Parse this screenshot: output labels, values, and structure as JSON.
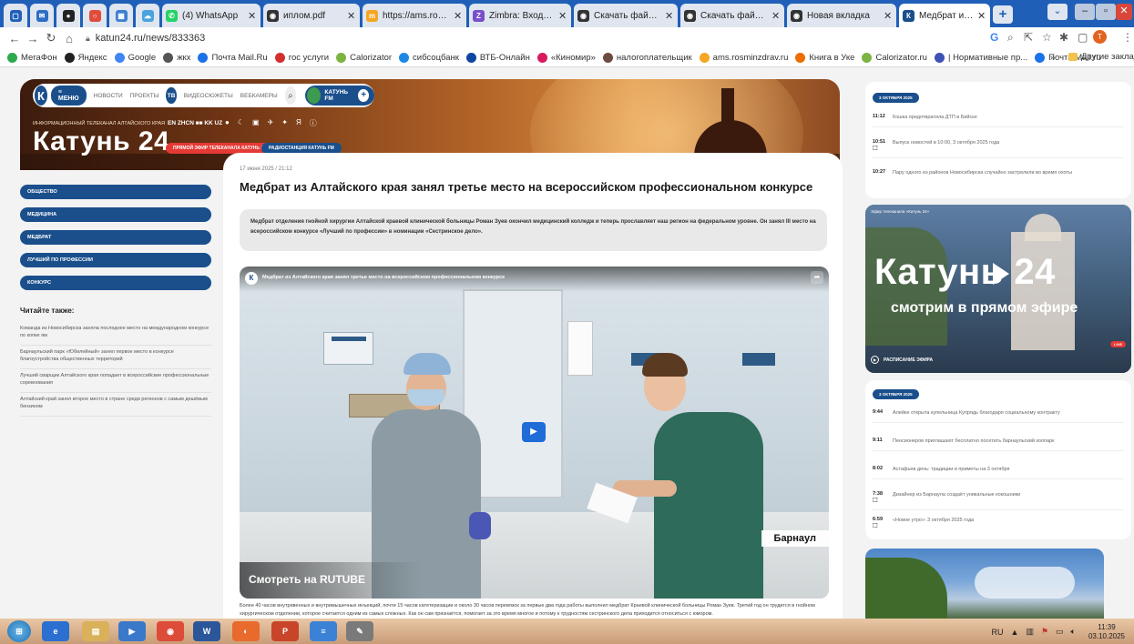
{
  "browser": {
    "tabs": [
      {
        "label": "",
        "favicon": "chrome-app-icon",
        "color": "#1f5fb8"
      },
      {
        "label": "",
        "favicon": "mail-app-icon",
        "color": "#2d6cc7"
      },
      {
        "label": "",
        "favicon": "zen-icon",
        "color": "#222222"
      },
      {
        "label": "",
        "favicon": "circle-icon",
        "color": "#e04b3c"
      },
      {
        "label": "",
        "favicon": "chart-icon",
        "color": "#3d7fd1"
      },
      {
        "label": "",
        "favicon": "cloud-icon",
        "color": "#4aa3df"
      },
      {
        "label": "(4) WhatsApp",
        "favicon": "whatsapp-icon",
        "color": "#25d366"
      },
      {
        "label": "иплом.pdf",
        "favicon": "pdf-icon",
        "color": "#333333"
      },
      {
        "label": "https://ams.rosminzd",
        "favicon": "ams-icon",
        "color": "#f5a623"
      },
      {
        "label": "Zimbra: Входящие (1",
        "favicon": "zimbra-icon",
        "color": "#7b4fc9"
      },
      {
        "label": "Скачать файл | iLovel",
        "favicon": "ilove-icon",
        "color": "#333333"
      },
      {
        "label": "Скачать файл | iLovel",
        "favicon": "ilove-icon",
        "color": "#333333"
      },
      {
        "label": "Новая вкладка",
        "favicon": "newtab-icon",
        "color": "#333333"
      },
      {
        "label": "Медбрат из Алтайск",
        "favicon": "katun-icon",
        "color": "#1a4f8c"
      }
    ],
    "url": "katun24.ru/news/833363",
    "bookmarks": [
      {
        "label": "МегаФон",
        "color": "#2eaa4c"
      },
      {
        "label": "Яндекс",
        "color": "#222222"
      },
      {
        "label": "Google",
        "color": "#4285f4"
      },
      {
        "label": "жкх",
        "color": "#555555"
      },
      {
        "label": "Почта Mail.Ru",
        "color": "#1a73e8"
      },
      {
        "label": "гос услуги",
        "color": "#d32f2f"
      },
      {
        "label": "Calorizator",
        "color": "#7cb342"
      },
      {
        "label": "сибсоцбанк",
        "color": "#1e88e5"
      },
      {
        "label": "ВТБ-Онлайн",
        "color": "#0d47a1"
      },
      {
        "label": "«Киномир»",
        "color": "#d81b60"
      },
      {
        "label": "налогоплательщик",
        "color": "#6d4c41"
      },
      {
        "label": "ams.rosminzdrav.ru",
        "color": "#f5a623"
      },
      {
        "label": "Книга в Уке",
        "color": "#ef6c00"
      },
      {
        "label": "Calorizator.ru",
        "color": "#7cb342"
      },
      {
        "label": "| Нормативные пр...",
        "color": "#3f51b5"
      },
      {
        "label": "Почта Mail.ru",
        "color": "#1a73e8"
      }
    ],
    "bookmarks_more": "»",
    "other_bookmarks": "Другие заклад"
  },
  "site": {
    "logo_letter": "К",
    "menu_label": "МЕНЮ",
    "nav": [
      "НОВОСТИ",
      "ПРОЕКТЫ"
    ],
    "tv_label": "ТВ",
    "nav2": [
      "ВИДЕОСЮЖЕТЫ",
      "ВЕБКАМЕРЫ"
    ],
    "fm_label": "КАТУНЬ FM",
    "tagline": "ИНФОРМАЦИОННЫЙ ТЕЛЕКАНАЛ АЛТАЙСКОГО КРАЯ",
    "langs": "EN ZHCN ■■ KK UZ",
    "title": "Катунь 24",
    "pill_live": "ПРЯМОЙ ЭФИР ТЕЛЕКАНАЛА КАТУНЬ 24",
    "pill_radio": "РАДИОСТАНЦИЯ КАТУНЬ FM",
    "brand_color": "#1a4f8c"
  },
  "sidebar": {
    "tags": [
      "ОБЩЕСТВО",
      "МЕДИЦИНА",
      "МЕДБРАТ",
      "ЛУЧШИЙ ПО ПРОФЕССИИ",
      "КОНКУРС"
    ],
    "read_also_title": "Читайте также:",
    "read_also": [
      "Команда из Новосибирска заняла последнее место на международном конкурсе по копке ям",
      "Барнаульский парк «Юбилейный» занял первое место в конкурсе благоустройства общественных территорий",
      "Лучший сварщик Алтайского края попадает в всероссийские профессиональные соревнования",
      "Алтайский край занял второе место в стране среди регионов с самым дешёвым бензином"
    ]
  },
  "article": {
    "date": "17 июня 2025 / 21:12",
    "headline": "Медбрат из Алтайского края занял третье место на всероссийском профессиональном конкурсе",
    "lead": "Медбрат отделения гнойной хирургии Алтайской краевой клинической больницы Роман Зуев окончил медицинский колледж и теперь прославляет наш регион на федеральном уровне. Он занял III место на всероссийском конкурсе «Лучший по профессии» в номинации «Сестринское дело».",
    "video": {
      "title": "Медбрат из Алтайского края занял третье место на всероссийском профессиональном конкурсе",
      "city": "Барнаул",
      "rutube": "Смотреть на RUTUBE"
    },
    "body": "Более 40 часов внутривенных и внутримышечных инъекций, почти 15 часов катетеризации и около 30 часов перевязок за первые два года работы выполнил медбрат Краевой клинической больницы Роман Зуев. Третий год он трудится в гнойном хирургическом отделении, которое считается одним из самых сложных. Как он сам признаётся, помогает за это время многое и потому к трудностям сестринского дела приходится относиться с юмором."
  },
  "right": {
    "feed1": {
      "date": "3 ОКТЯБРЯ 2025",
      "items": [
        {
          "time": "11:12",
          "video": false,
          "text": "Кошка предотвратила ДТП в Бийске"
        },
        {
          "time": "10:51",
          "video": true,
          "text": "Выпуск новостей в 10:00, 3 октября 2025 года"
        },
        {
          "time": "10:27",
          "video": false,
          "text": "Пару одного из районов Новосибирска случайно застрелили во время охоты"
        }
      ]
    },
    "live": {
      "label": "Эфир телеканала «Катунь 24»",
      "title": "Катунь 24",
      "subtitle": "смотрим в прямом эфире",
      "badge": "LIVE",
      "schedule": "РАСПИСАНИЕ ЭФИРА"
    },
    "feed2": {
      "date": "3 ОКТЯБРЯ 2025",
      "items": [
        {
          "time": "9:44",
          "video": false,
          "text": "Алейке открыта купельница Купрядь благодаря социальному контракту"
        },
        {
          "time": "9:11",
          "video": false,
          "text": "Пенсионеров приглашают бесплатно посетить барнаульский зоопарк"
        },
        {
          "time": "8:02",
          "video": false,
          "text": "Астафьев день: традиции и приметы на 3 октября"
        },
        {
          "time": "7:38",
          "video": true,
          "text": "Дизайнер из Барнаула создаёт уникальные кокошники"
        },
        {
          "time": "6:59",
          "video": true,
          "text": "«Новое утро»: 3 октября 2025 года"
        }
      ]
    }
  },
  "taskbar": {
    "lang": "RU",
    "time": "11:39",
    "date": "03.10.2025"
  }
}
